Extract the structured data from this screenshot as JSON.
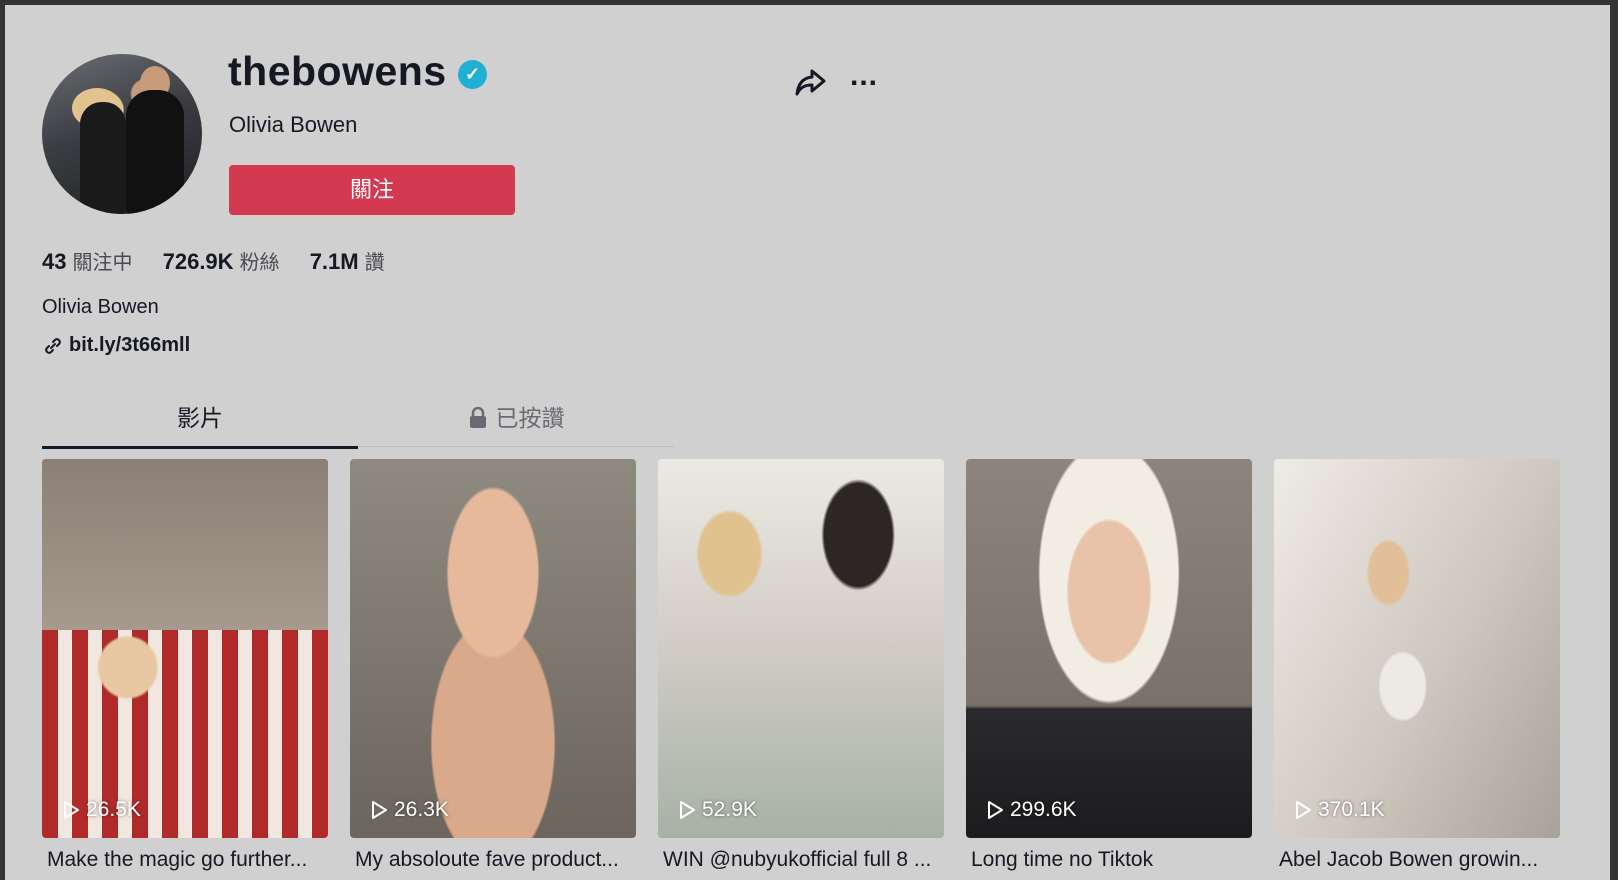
{
  "profile": {
    "username": "thebowens",
    "verified_mark": "✓",
    "nickname": "Olivia Bowen",
    "follow_label": "關注",
    "bio": "Olivia Bowen",
    "link": "bit.ly/3t66mll"
  },
  "stats": {
    "following_count": "43",
    "following_label": "關注中",
    "followers_count": "726.9K",
    "followers_label": "粉絲",
    "likes_count": "7.1M",
    "likes_label": "讚"
  },
  "actions": {
    "more_label": "..."
  },
  "tabs": {
    "videos": "影片",
    "liked": "已按讚"
  },
  "videos": [
    {
      "views": "26.5K",
      "caption": "Make the magic go further..."
    },
    {
      "views": "26.3K",
      "caption": "My absoloute fave product..."
    },
    {
      "views": "52.9K",
      "caption": "WIN @nubyukofficial full 8 ..."
    },
    {
      "views": "299.6K",
      "caption": "Long time no Tiktok"
    },
    {
      "views": "370.1K",
      "caption": "Abel Jacob Bowen growin..."
    }
  ],
  "colors": {
    "follow_button": "#d33a51",
    "verified_badge": "#20b0d6",
    "background": "#d0d0d0"
  }
}
